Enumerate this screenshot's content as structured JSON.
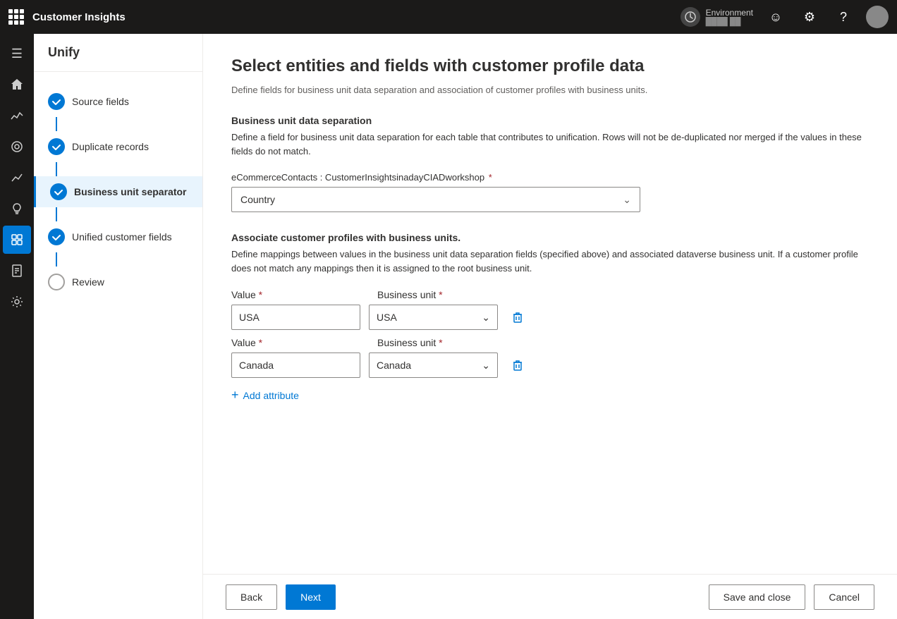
{
  "app": {
    "title": "Customer Insights",
    "page_title": "Unify"
  },
  "topbar": {
    "environment_label": "Environment",
    "environment_id": "████ ██"
  },
  "left_nav": {
    "header": "Unify",
    "steps": [
      {
        "id": "source-fields",
        "label": "Source fields",
        "status": "completed",
        "bold": false
      },
      {
        "id": "duplicate-records",
        "label": "Duplicate records",
        "status": "completed",
        "bold": false
      },
      {
        "id": "business-unit-separator",
        "label": "Business unit separator",
        "status": "active",
        "bold": true
      },
      {
        "id": "unified-customer-fields",
        "label": "Unified customer fields",
        "status": "completed",
        "bold": false
      },
      {
        "id": "review",
        "label": "Review",
        "status": "empty",
        "bold": false
      }
    ]
  },
  "content": {
    "page_title": "Select entities and fields with customer profile data",
    "page_subtitle": "Define fields for business unit data separation and association of customer profiles with business units.",
    "business_unit_section": {
      "title": "Business unit data separation",
      "description": "Define a field for business unit data separation for each table that contributes to unification. Rows will not be de-duplicated nor merged if the values in these fields do not match.",
      "entity_label_prefix": "eCommerceContacts : CustomerInsightsinadayCIADworkshop",
      "dropdown_value": "Country"
    },
    "associate_section": {
      "title": "Associate customer profiles with business units.",
      "description": "Define mappings between values in the business unit data separation fields (specified above) and associated dataverse business unit. If a customer profile does not match any mappings then it is assigned to the root business unit.",
      "value_label": "Value",
      "business_unit_label": "Business unit",
      "rows": [
        {
          "value": "USA",
          "business_unit": "USA"
        },
        {
          "value": "Canada",
          "business_unit": "Canada"
        }
      ],
      "add_attribute_label": "Add attribute"
    }
  },
  "footer": {
    "back_label": "Back",
    "next_label": "Next",
    "save_close_label": "Save and close",
    "cancel_label": "Cancel"
  },
  "icons": {
    "grid": "⊞",
    "home": "⌂",
    "analytics": "📊",
    "target": "◎",
    "chart": "📈",
    "bulb": "💡",
    "segment": "⬡",
    "report": "📋",
    "settings": "⚙",
    "face": "☺",
    "gear": "⚙",
    "help": "?",
    "chevron_down": "⌄",
    "delete": "🗑",
    "plus": "+"
  }
}
